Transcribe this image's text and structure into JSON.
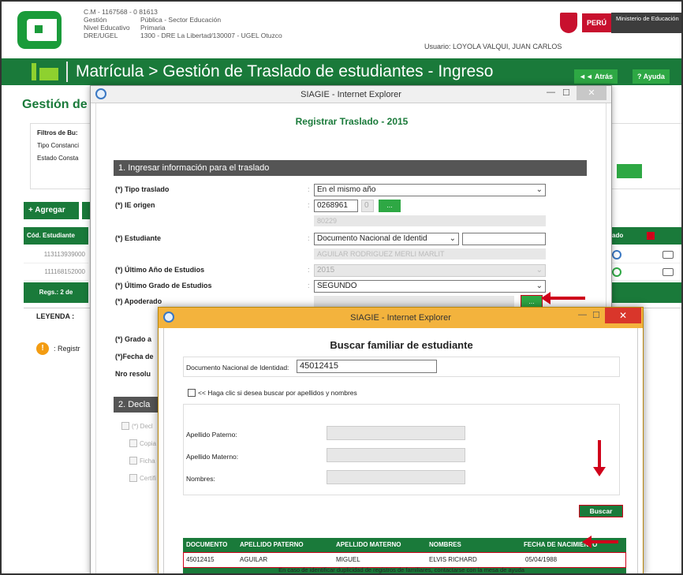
{
  "header": {
    "cm": "C.M - 1167568 - 0",
    "cm_code": "81613",
    "meta": [
      {
        "k": "Gestión",
        "v": "Pública - Sector Educación"
      },
      {
        "k": "Nivel Educativo",
        "v": "Primaria"
      },
      {
        "k": "DRE/UGEL",
        "v": "1300 - DRE La Libertad/130007 - UGEL Otuzco"
      }
    ],
    "usuario": "Usuario: LOYOLA VALQUI, JUAN CARLOS",
    "peru": "PERÚ",
    "ministerio": "Ministerio de Educación"
  },
  "nav": {
    "title": "Matrícula > Gestión de Traslado de estudiantes - Ingreso",
    "atras": "◄◄ Atrás",
    "ayuda": "? Ayuda"
  },
  "bg": {
    "title": "Gestión de",
    "filters_title": "Filtros de Bu:",
    "filter1": "Tipo Constanci",
    "filter2": "Estado Consta",
    "agregar": "+ Agregar",
    "col_codigo": "Cód. Estudiante",
    "row1": "113113939000",
    "row2": "111168152000",
    "regs": "Regs.: 2 de",
    "leyenda": "LEYENDA :",
    "registro": ": Registr",
    "col_estado": "ado"
  },
  "modal1": {
    "window_title": "SIAGIE - Internet Explorer",
    "heading": "Registrar Traslado - 2015",
    "section1": "1. Ingresar información para el traslado",
    "fields": {
      "tipo_label": "(*) Tipo traslado",
      "tipo_value": "En el mismo año",
      "ie_label": "(*) IE origen",
      "ie_code": "0268961",
      "ie_anexo": "0",
      "ie_sub": "80229",
      "est_label": "(*) Estudiante",
      "est_doc": "Documento Nacional de Identid",
      "est_name": "AGUILAR RODRIGUEZ MERLI MARLIT",
      "anio_label": "(*) Último Año de Estudios",
      "anio_value": "2015",
      "grado_label": "(*) Último Grado de Estudios",
      "grado_value": "SEGUNDO",
      "apod_label": "(*) Apoderado",
      "grado_a_label": "(*) Grado a",
      "fecha_label": "(*)Fecha de",
      "nro_label": "Nro resolu"
    },
    "section2": "2. Decla",
    "checks": [
      "(*) Decl",
      "Copia",
      "Ficha",
      "Certifi"
    ],
    "btn_dots": "..."
  },
  "modal2": {
    "window_title": "SIAGIE - Internet Explorer",
    "heading": "Buscar familiar de estudiante",
    "doc_label": "Documento Nacional de Identidad:",
    "doc_value": "45012415",
    "check_label": "<< Haga clic si desea buscar por apellidos y nombres",
    "ap_pat": "Apellido Paterno:",
    "ap_mat": "Apellido Materno:",
    "nombres": "Nombres:",
    "buscar": "Buscar",
    "table": {
      "headers": [
        "DOCUMENTO",
        "APELLIDO PATERNO",
        "APELLIDO MATERNO",
        "NOMBRES",
        "FECHA DE NACIMIENTO"
      ],
      "row": [
        "45012415",
        "AGUILAR",
        "MIGUEL",
        "ELVIS RICHARD",
        "05/04/1988"
      ]
    },
    "note": "En caso de identificar duplicidad de registros de familiares, contactarse con la mesa de ayuda"
  },
  "colors": {
    "green": "#1a7a3a",
    "red": "#d0021b",
    "orange_titlebar": "#f3b33d"
  }
}
